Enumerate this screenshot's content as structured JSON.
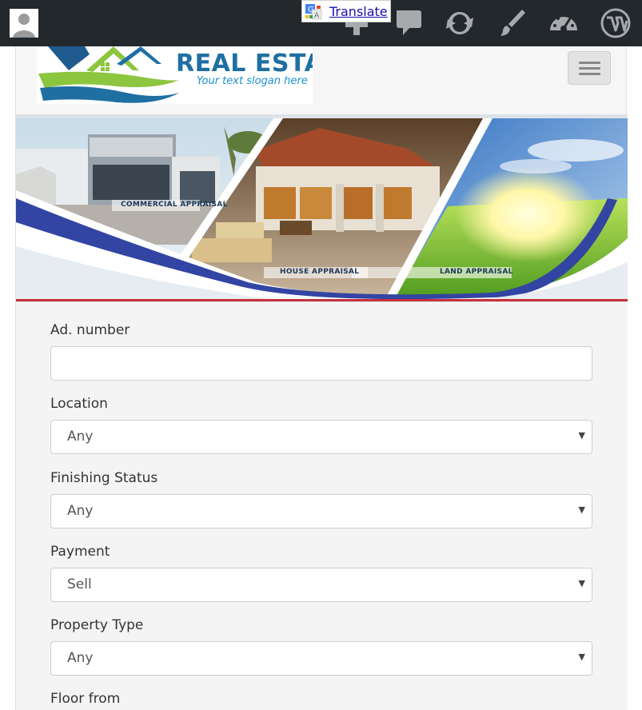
{
  "adminbar": {
    "translate_label": "Translate",
    "icons": [
      "avatar-icon",
      "new-content-icon",
      "comments-icon",
      "updates-icon",
      "customize-icon",
      "dashboard-icon",
      "wordpress-icon"
    ],
    "background": "#23282d"
  },
  "header": {
    "logo_title": "REAL ESTATE",
    "logo_slogan": "Your text slogan here",
    "menu_toggle": "menu-toggle"
  },
  "banner": {
    "captions": [
      "COMMERCIAL APPRAISAL",
      "HOUSE APPRAISAL",
      "LAND APPRAISAL"
    ]
  },
  "form": {
    "fields": [
      {
        "label": "Ad. number",
        "type": "text",
        "value": ""
      },
      {
        "label": "Location",
        "type": "select",
        "value": "Any"
      },
      {
        "label": "Finishing Status",
        "type": "select",
        "value": "Any"
      },
      {
        "label": "Payment",
        "type": "select",
        "value": "Sell"
      },
      {
        "label": "Property Type",
        "type": "select",
        "value": "Any"
      },
      {
        "label": "Floor from",
        "type": "label"
      }
    ]
  },
  "colors": {
    "accent_red": "#c7303b",
    "logo_blue": "#1f6fa3",
    "logo_green": "#8cc63f",
    "swoosh_blue": "#3345a3"
  }
}
